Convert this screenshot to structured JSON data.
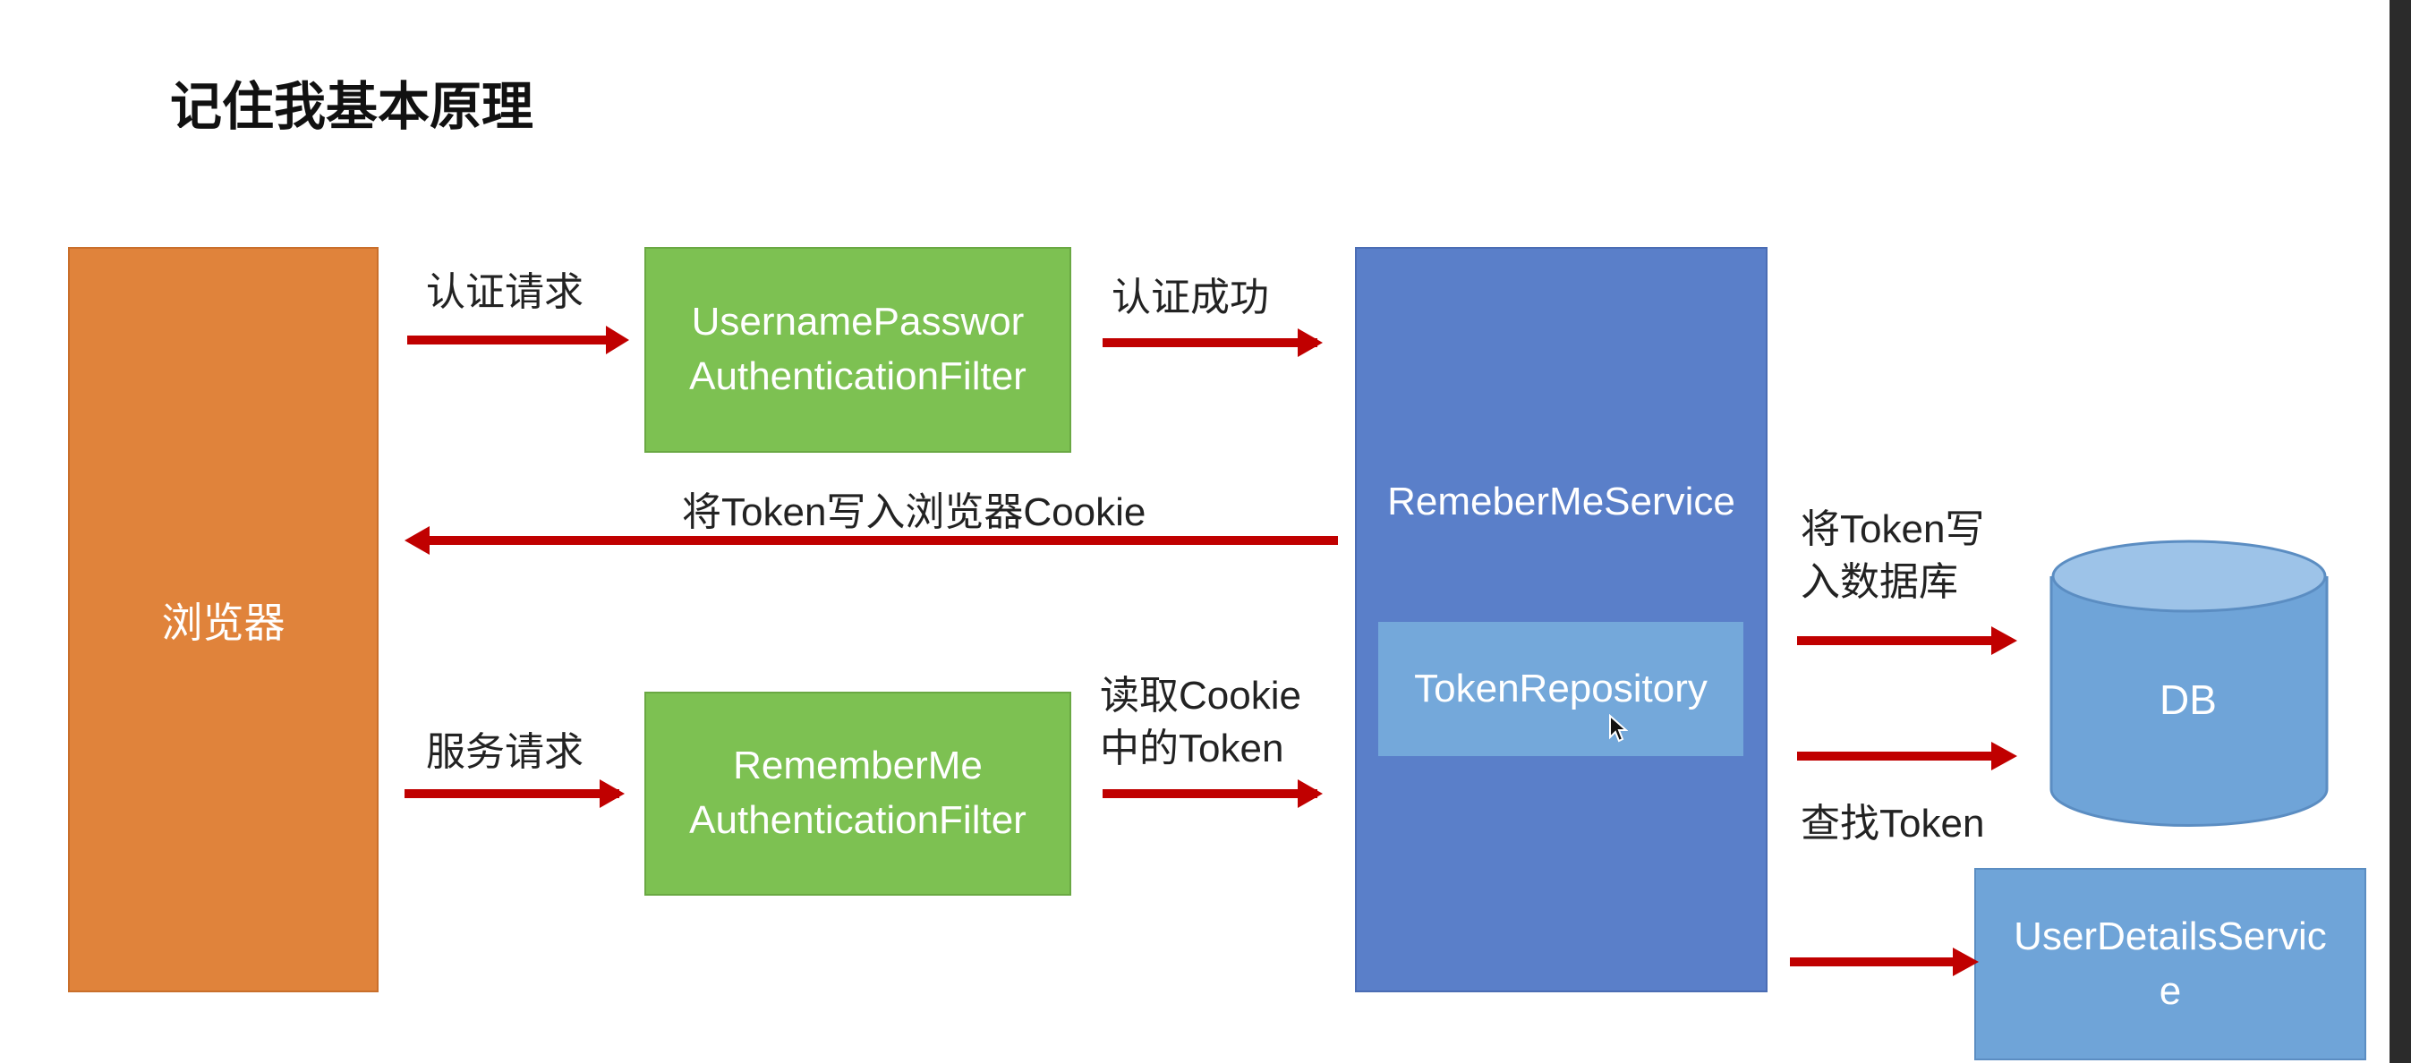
{
  "title": "记住我基本原理",
  "boxes": {
    "browser": "浏览器",
    "username_filter": [
      "UsernamePasswor",
      "AuthenticationFilter"
    ],
    "rememberme_filter": [
      "RememberMe",
      "AuthenticationFilter"
    ],
    "rememberme_service": "RemeberMeService",
    "token_repository": "TokenRepository",
    "db": "DB",
    "user_details_service": [
      "UserDetailsServic",
      "e"
    ]
  },
  "labels": {
    "auth_request": "认证请求",
    "auth_success": "认证成功",
    "write_cookie": "将Token写入浏览器Cookie",
    "write_db": [
      "将Token写",
      "入数据库"
    ],
    "service_request": "服务请求",
    "read_cookie": [
      "读取Cookie",
      "中的Token"
    ],
    "find_token": "查找Token"
  },
  "colors": {
    "browser": "#e0833b",
    "filter": "#7dc152",
    "service": "#5a7fc9",
    "repository": "#74a8da",
    "db": "#6fa4d8",
    "arrow": "#c00000"
  }
}
